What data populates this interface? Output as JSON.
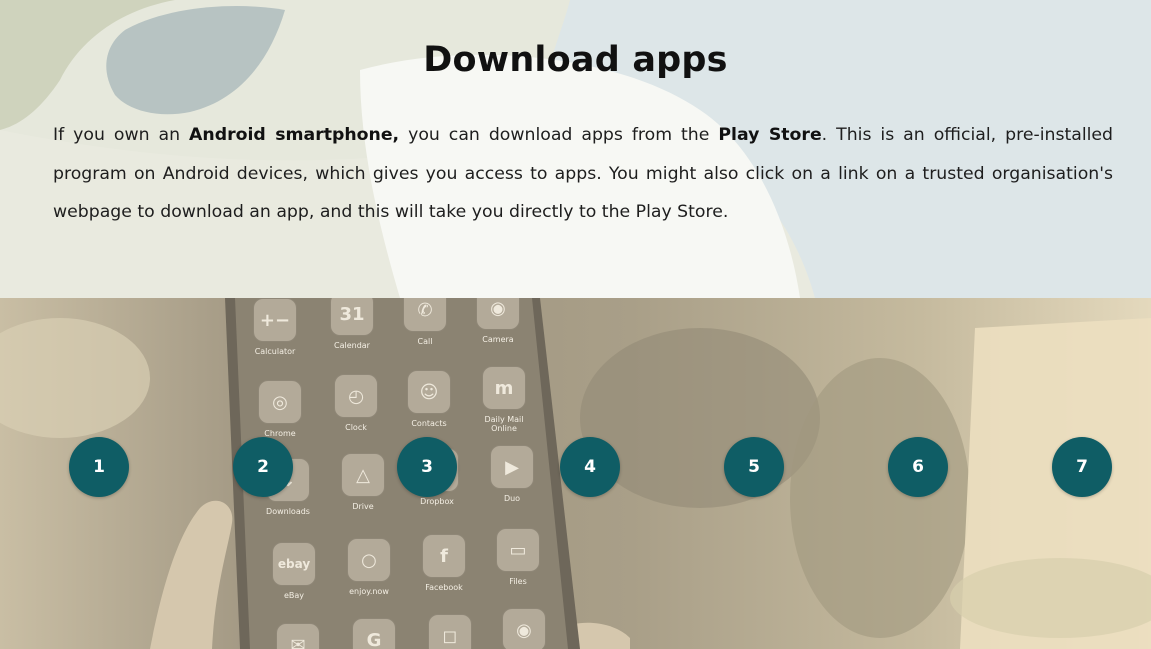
{
  "slide": {
    "title": "Download apps",
    "paragraph": {
      "t1": "If you own an ",
      "b1": "Android smartphone,",
      "t2": " you can download apps from the ",
      "b2": "Play Store",
      "t3": ". This is an official, pre-installed program on Android devices, which gives you access to apps. You might also click on a link on a trusted organisation's webpage to download an app, and this will take you directly to the Play Store."
    }
  },
  "phone_apps": [
    {
      "label": "Calculator",
      "glyph": "+−"
    },
    {
      "label": "Calendar",
      "glyph": "31"
    },
    {
      "label": "Call",
      "glyph": "✆"
    },
    {
      "label": "Camera",
      "glyph": "◉"
    },
    {
      "label": "Chrome",
      "glyph": "◎"
    },
    {
      "label": "Clock",
      "glyph": "◴"
    },
    {
      "label": "Contacts",
      "glyph": "☺"
    },
    {
      "label": "Daily Mail Online",
      "glyph": "m"
    },
    {
      "label": "Downloads",
      "glyph": "↓"
    },
    {
      "label": "Drive",
      "glyph": "△"
    },
    {
      "label": "Dropbox",
      "glyph": "◇"
    },
    {
      "label": "Duo",
      "glyph": "▶"
    },
    {
      "label": "eBay",
      "glyph": "ebay"
    },
    {
      "label": "enjoy.now",
      "glyph": "○"
    },
    {
      "label": "Facebook",
      "glyph": "f"
    },
    {
      "label": "Files",
      "glyph": "▭"
    }
  ],
  "hotspots": [
    "1",
    "2",
    "3",
    "4",
    "5",
    "6",
    "7"
  ],
  "colors": {
    "hotspot_fill": "#0f5d65",
    "photo_tint": "#b8ad94",
    "header_bg": "#f3f3ef"
  },
  "icons": {
    "bottom_row": [
      "mail-icon",
      "google-icon",
      "instagram-icon",
      "camera-lens-icon"
    ]
  }
}
